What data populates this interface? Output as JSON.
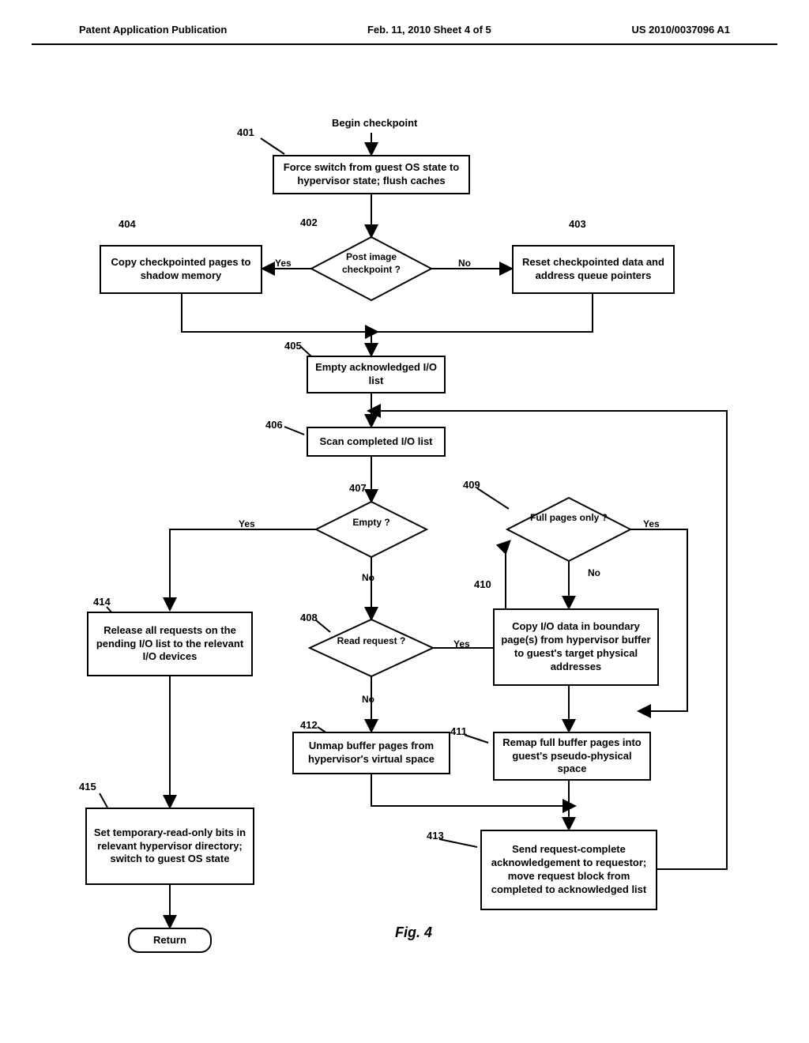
{
  "header": {
    "left": "Patent Application Publication",
    "center": "Feb. 11, 2010  Sheet 4 of 5",
    "right": "US 2010/0037096 A1"
  },
  "flow": {
    "begin": "Begin checkpoint",
    "n401": "401",
    "b401": "Force switch from guest OS state to hypervisor state; flush caches",
    "n402": "402",
    "d402": "Post image checkpoint ?",
    "n403": "403",
    "b403": "Reset checkpointed data and address queue pointers",
    "n404": "404",
    "b404": "Copy checkpointed pages to shadow memory",
    "n405": "405",
    "b405": "Empty acknowledged I/O list",
    "n406": "406",
    "b406": "Scan completed I/O list",
    "n407": "407",
    "d407": "Empty ?",
    "n408": "408",
    "d408": "Read request ?",
    "n409": "409",
    "d409": "Full pages only ?",
    "n410": "410",
    "b410": "Copy I/O data in boundary page(s) from hypervisor buffer to guest's target physical addresses",
    "n411": "411",
    "b411": "Remap full buffer pages into guest's pseudo-physical space",
    "n412": "412",
    "b412": "Unmap buffer pages from hypervisor's virtual space",
    "n413": "413",
    "b413": "Send request-complete acknowledgement to requestor; move request block from completed to acknowledged list",
    "n414": "414",
    "b414": "Release all requests on the pending I/O list to the relevant I/O devices",
    "n415": "415",
    "b415": "Set temporary-read-only bits in relevant hypervisor directory; switch to guest OS state",
    "return": "Return",
    "yes": "Yes",
    "no": "No"
  },
  "figure": "Fig. 4"
}
